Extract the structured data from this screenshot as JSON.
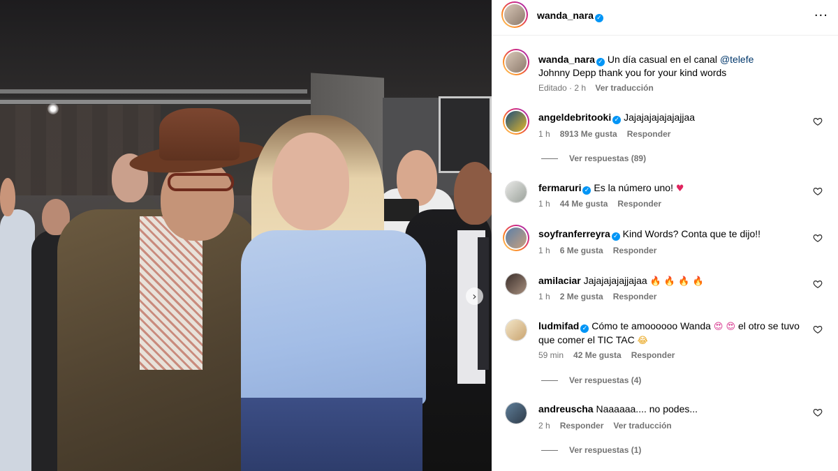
{
  "post": {
    "author": "wanda_nara",
    "author_verified": true,
    "caption_line1": "Un día casual en el canal",
    "caption_mention": "@telefe",
    "caption_line2": "Johnny Depp thank you for your kind words",
    "edited_label": "Editado",
    "time": "2 h",
    "translate_label": "Ver traducción",
    "more_icon": "more-horizontal-icon",
    "carousel_next_icon": "chevron-right-icon"
  },
  "comments": [
    {
      "user": "angeldebritooki",
      "verified": true,
      "text": "Jajajajajajajajjaa",
      "time": "1 h",
      "likes": "8913 Me gusta",
      "reply": "Responder",
      "replies": "Ver respuestas (89)"
    },
    {
      "user": "fermaruri",
      "verified": true,
      "text": "Es la número uno!",
      "emoji": "♥",
      "time": "1 h",
      "likes": "44 Me gusta",
      "reply": "Responder"
    },
    {
      "user": "soyfranferreyra",
      "verified": true,
      "text": "Kind Words? Conta que te dijo!!",
      "time": "1 h",
      "likes": "6 Me gusta",
      "reply": "Responder"
    },
    {
      "user": "amilaciar",
      "verified": false,
      "text": "Jajajajajajjajaa",
      "emoji": "🔥 🔥 🔥 🔥",
      "time": "1 h",
      "likes": "2 Me gusta",
      "reply": "Responder"
    },
    {
      "user": "ludmifad",
      "verified": true,
      "text_a": "Cómo te amoooooo Wanda",
      "emoji_a": "😍 😍",
      "text_b": "el otro se tuvo que comer el TIC TAC",
      "emoji_b": "😂",
      "time": "59 min",
      "likes": "42 Me gusta",
      "reply": "Responder",
      "replies": "Ver respuestas (4)"
    },
    {
      "user": "andreuscha",
      "verified": false,
      "text": "Naaaaaa.... no podes...",
      "time": "2 h",
      "reply": "Responder",
      "translate": "Ver traducción",
      "replies": "Ver respuestas (1)"
    }
  ],
  "colors": {
    "verified": "#0095f6",
    "meta": "#737373",
    "mention": "#00376b"
  }
}
